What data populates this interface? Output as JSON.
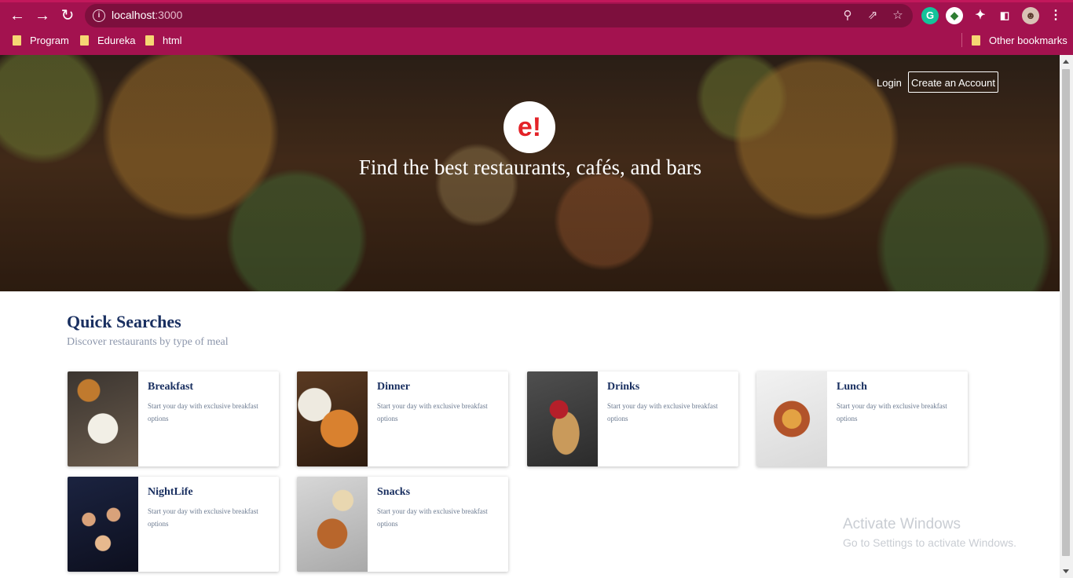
{
  "browser": {
    "url_host": "localhost",
    "url_port": ":3000",
    "bookmarks": [
      "Program",
      "Edureka",
      "html"
    ],
    "other_bookmarks": "Other bookmarks",
    "accent": "#a3124f"
  },
  "header": {
    "login": "Login",
    "create_account": "Create an Account",
    "logo": "e!",
    "tagline": "Find the best restaurants, cafés, and bars"
  },
  "quick_searches": {
    "title": "Quick Searches",
    "subtitle": "Discover restaurants by type of meal",
    "items": [
      {
        "title": "Breakfast",
        "desc": "Start your day with exclusive breakfast options"
      },
      {
        "title": "Dinner",
        "desc": "Start your day with exclusive breakfast options"
      },
      {
        "title": "Drinks",
        "desc": "Start your day with exclusive breakfast options"
      },
      {
        "title": "Lunch",
        "desc": "Start your day with exclusive breakfast options"
      },
      {
        "title": "NightLife",
        "desc": "Start your day with exclusive breakfast options"
      },
      {
        "title": "Snacks",
        "desc": "Start your day with exclusive breakfast options"
      }
    ]
  },
  "watermark": {
    "line1": "Activate Windows",
    "line2": "Go to Settings to activate Windows."
  }
}
